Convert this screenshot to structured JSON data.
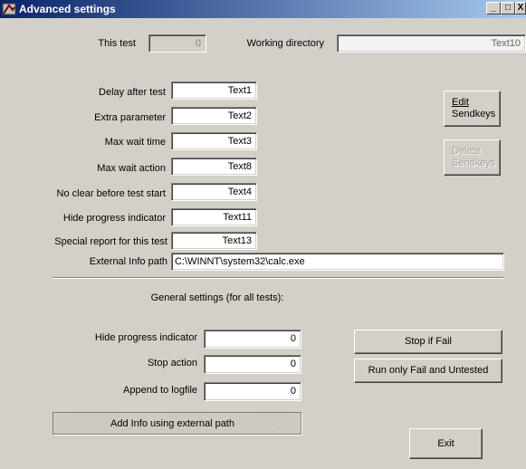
{
  "window": {
    "title": "Advanced settings",
    "minimize_glyph": "_",
    "maximize_glyph": "□",
    "close_glyph": "X"
  },
  "top": {
    "this_test_label": "This test",
    "this_test_value": "0",
    "working_dir_label": "Working directory",
    "working_dir_value": "Text10"
  },
  "per_test": {
    "fields": [
      {
        "label": "Delay after test",
        "value": "Text1"
      },
      {
        "label": "Extra parameter",
        "value": "Text2"
      },
      {
        "label": "Max wait time",
        "value": "Text3"
      },
      {
        "label": "Max wait action",
        "value": "Text8"
      },
      {
        "label": "No clear before test start",
        "value": "Text4"
      },
      {
        "label": "Hide progress indicator",
        "value": "Text11"
      },
      {
        "label": "Special report for this test",
        "value": "Text13"
      }
    ],
    "external_info_label": "External Info path",
    "external_info_value": "C:\\WINNT\\system32\\calc.exe"
  },
  "buttons": {
    "edit_sendkeys_line1": "Edit",
    "edit_sendkeys_line2": "Sendkeys",
    "delete_sendkeys_line1": "Delete",
    "delete_sendkeys_line2": "Sendkeys",
    "stop_if_fail": "Stop if Fail",
    "run_only_fail": "Run only Fail and Untested",
    "add_info": "Add Info using external path",
    "exit": "Exit"
  },
  "general": {
    "heading": "General settings (for all tests):",
    "fields": [
      {
        "label": "Hide progress indicator",
        "value": "0"
      },
      {
        "label": "Stop action",
        "value": "0"
      },
      {
        "label": "Append to logfile",
        "value": "0"
      }
    ]
  }
}
